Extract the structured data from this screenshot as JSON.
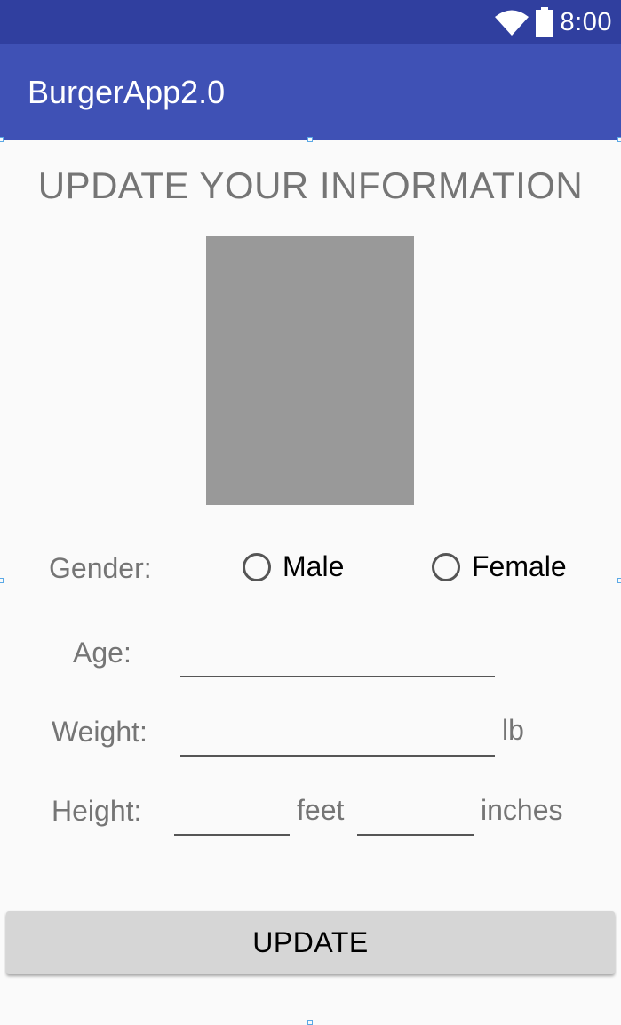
{
  "status_bar": {
    "time": "8:00",
    "icons": [
      "wifi-icon",
      "battery-icon"
    ]
  },
  "app_bar": {
    "title": "BurgerApp2.0"
  },
  "form": {
    "title": "UPDATE YOUR INFORMATION",
    "gender": {
      "label": "Gender:",
      "options": [
        "Male",
        "Female"
      ],
      "selected": null
    },
    "age": {
      "label": "Age:",
      "value": ""
    },
    "weight": {
      "label": "Weight:",
      "value": "",
      "unit": "lb"
    },
    "height": {
      "label": "Height:",
      "feet_value": "",
      "feet_unit": "feet",
      "inches_value": "",
      "inches_unit": "inches"
    },
    "update_button_label": "UPDATE"
  },
  "colors": {
    "status_bar": "#303f9f",
    "app_bar": "#3f51b5",
    "background": "#fafafa",
    "image_placeholder": "#999999",
    "button": "#d6d6d6",
    "label_text": "#757575"
  }
}
